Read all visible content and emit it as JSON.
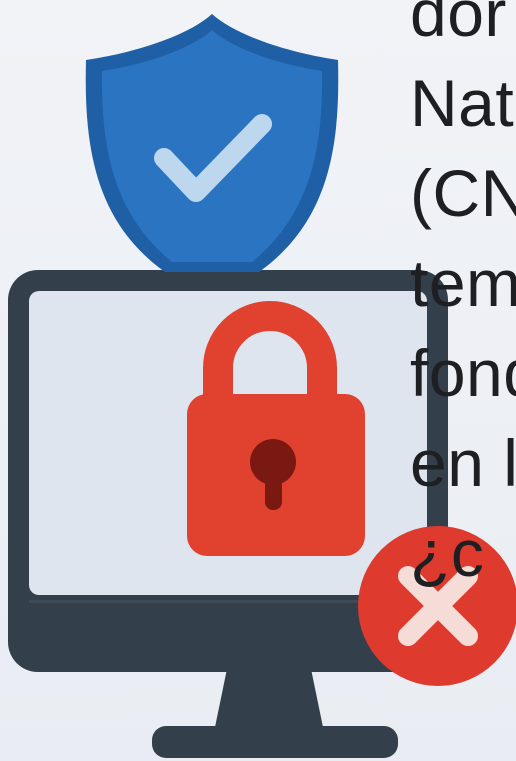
{
  "text_lines": [
    "dor",
    "Nat",
    "(CN",
    "tem",
    "fond",
    "en l",
    "¿c"
  ],
  "colors": {
    "background": "#eef1f6",
    "shield": "#2a74c2",
    "shield_dark": "#1f5fa5",
    "check": "#bcd7ee",
    "monitor_frame": "#333f4b",
    "screen": "#dfe5ee",
    "lock": "#e1412f",
    "keyhole": "#7a1812",
    "error_badge": "#de3b2e",
    "error_cross": "#f6dcd6",
    "text": "#1e1f22"
  },
  "icons": [
    "shield-check-icon",
    "monitor-icon",
    "padlock-icon",
    "error-x-icon"
  ]
}
